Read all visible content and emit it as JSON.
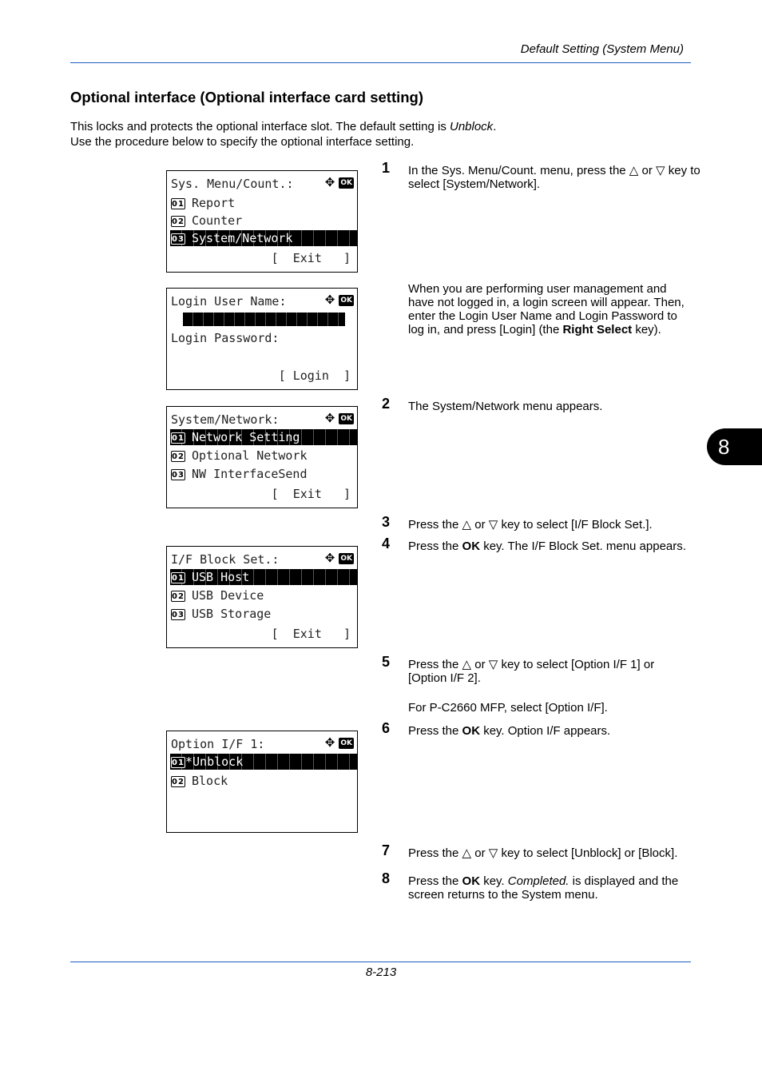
{
  "header": {
    "title": "Default Setting (System Menu)"
  },
  "section": {
    "title": "Optional interface (Optional interface card setting)",
    "intro_line1_before": "This locks and protects the optional interface slot. The default setting is ",
    "intro_line1_italic": "Unblock",
    "intro_line1_after": ".",
    "intro_line2": "Use the procedure below to specify the optional interface setting."
  },
  "chapter_tab": "8",
  "page_number": "8-213",
  "icons": {
    "nav": "four-way-arrow-icon",
    "ok": "OK"
  },
  "screens": [
    {
      "title": "Sys. Menu/Count.:",
      "items": [
        {
          "num": "01",
          "label": "Report",
          "selected": false
        },
        {
          "num": "02",
          "label": "Counter",
          "selected": false
        },
        {
          "num": "03",
          "label": "System/Network",
          "selected": true
        }
      ],
      "softkey": "[  Exit   ]"
    },
    {
      "title": "Login User Name:",
      "password_label": "Login Password:",
      "softkey": "[ Login  ]"
    },
    {
      "title": "System/Network:",
      "items": [
        {
          "num": "01",
          "label": "Network Setting",
          "selected": true
        },
        {
          "num": "02",
          "label": "Optional Network",
          "selected": false
        },
        {
          "num": "03",
          "label": "NW InterfaceSend",
          "selected": false
        }
      ],
      "softkey": "[  Exit   ]"
    },
    {
      "title": "I/F Block Set.:",
      "items": [
        {
          "num": "01",
          "label": "USB Host",
          "selected": true
        },
        {
          "num": "02",
          "label": "USB Device",
          "selected": false
        },
        {
          "num": "03",
          "label": "USB Storage",
          "selected": false
        }
      ],
      "softkey": "[  Exit   ]"
    },
    {
      "title": "Option I/F 1:",
      "items": [
        {
          "num": "01",
          "label": "*Unblock",
          "selected": true
        },
        {
          "num": "02",
          "label": "Block",
          "selected": false
        }
      ]
    }
  ],
  "steps": [
    {
      "n": "1",
      "html_parts": [
        "In the Sys. Menu/Count. menu, press the △ or ▽ key to select [System/Network]."
      ]
    },
    {
      "n": "2",
      "html_parts": [
        "The System/Network menu appears."
      ]
    },
    {
      "n": "3",
      "html_parts": [
        "Press the △ or ▽ key to select [I/F Block Set.]."
      ]
    },
    {
      "n": "4",
      "pre": "Press the ",
      "bold": "OK",
      "post": " key. The I/F Block Set. menu appears."
    },
    {
      "n": "5",
      "html_parts": [
        "Press the △ or ▽ key to select [Option I/F 1] or [Option I/F 2]."
      ]
    },
    {
      "n": "6",
      "pre": "Press the ",
      "bold": "OK",
      "post": " key. Option I/F appears."
    },
    {
      "n": "7",
      "html_parts": [
        "Press the △ or ▽ key to select [Unblock] or [Block]."
      ]
    },
    {
      "n": "8",
      "pre": "Press the ",
      "bold": "OK",
      "post": " key. ",
      "italic": "Completed.",
      "post2": " is displayed and the screen returns to the System menu."
    }
  ],
  "notes": {
    "login_pre": "When you are performing user management and have not logged in, a login screen will appear. Then, enter the Login User Name and Login Password to log in, and press [Login] (the ",
    "login_bold": "Right Select",
    "login_post": " key).",
    "p_c2660": "For P-C2660 MFP, select [Option I/F]."
  }
}
